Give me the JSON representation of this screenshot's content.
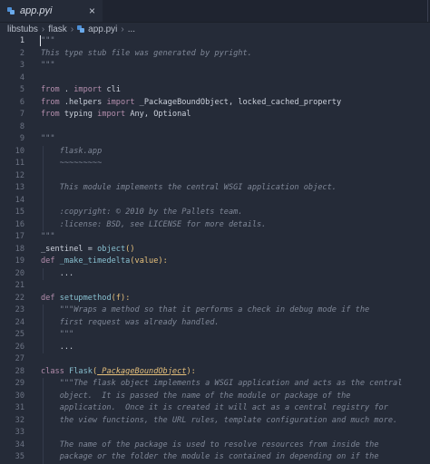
{
  "tab": {
    "label": "app.pyi",
    "close": "×"
  },
  "breadcrumb": [
    "libstubs",
    "flask",
    "app.pyi",
    "..."
  ],
  "lines": [
    {
      "n": "1",
      "parts": [
        {
          "t": "\"\"\"",
          "c": "str"
        }
      ]
    },
    {
      "n": "2",
      "parts": [
        {
          "t": "This type stub file was generated by pyright.",
          "c": "str"
        }
      ]
    },
    {
      "n": "3",
      "parts": [
        {
          "t": "\"\"\"",
          "c": "str"
        }
      ]
    },
    {
      "n": "4",
      "parts": []
    },
    {
      "n": "5",
      "parts": [
        {
          "t": "from",
          "c": "kw"
        },
        {
          "t": " . ",
          "c": "plain"
        },
        {
          "t": "import",
          "c": "kw"
        },
        {
          "t": " cli",
          "c": "plain"
        }
      ]
    },
    {
      "n": "6",
      "parts": [
        {
          "t": "from",
          "c": "kw"
        },
        {
          "t": " .helpers ",
          "c": "plain"
        },
        {
          "t": "import",
          "c": "kw"
        },
        {
          "t": " _PackageBoundObject, locked_cached_property",
          "c": "plain"
        }
      ]
    },
    {
      "n": "7",
      "parts": [
        {
          "t": "from",
          "c": "kw"
        },
        {
          "t": " typing ",
          "c": "plain"
        },
        {
          "t": "import",
          "c": "kw"
        },
        {
          "t": " Any, Optional",
          "c": "plain"
        }
      ]
    },
    {
      "n": "8",
      "parts": []
    },
    {
      "n": "9",
      "parts": [
        {
          "t": "\"\"\"",
          "c": "str"
        }
      ]
    },
    {
      "n": "10",
      "parts": [
        {
          "t": "    flask.app",
          "c": "str"
        }
      ]
    },
    {
      "n": "11",
      "parts": [
        {
          "t": "    ~~~~~~~~~",
          "c": "str"
        }
      ]
    },
    {
      "n": "12",
      "parts": []
    },
    {
      "n": "13",
      "parts": [
        {
          "t": "    This module implements the central WSGI application object.",
          "c": "str"
        }
      ]
    },
    {
      "n": "14",
      "parts": []
    },
    {
      "n": "15",
      "parts": [
        {
          "t": "    :copyright: © 2010 by the Pallets team.",
          "c": "str"
        }
      ]
    },
    {
      "n": "16",
      "parts": [
        {
          "t": "    :license: BSD, see LICENSE for more details.",
          "c": "str"
        }
      ]
    },
    {
      "n": "17",
      "parts": [
        {
          "t": "\"\"\"",
          "c": "str"
        }
      ]
    },
    {
      "n": "18",
      "parts": [
        {
          "t": "_sentinel = ",
          "c": "plain"
        },
        {
          "t": "object",
          "c": "fn"
        },
        {
          "t": "()",
          "c": "paren"
        }
      ]
    },
    {
      "n": "19",
      "parts": [
        {
          "t": "def",
          "c": "kw"
        },
        {
          "t": " ",
          "c": "plain"
        },
        {
          "t": "_make_timedelta",
          "c": "fn"
        },
        {
          "t": "(",
          "c": "paren"
        },
        {
          "t": "value",
          "c": "param"
        },
        {
          "t": "):",
          "c": "paren"
        }
      ]
    },
    {
      "n": "20",
      "parts": [
        {
          "t": "    ...",
          "c": "plain"
        }
      ]
    },
    {
      "n": "21",
      "parts": []
    },
    {
      "n": "22",
      "parts": [
        {
          "t": "def",
          "c": "kw"
        },
        {
          "t": " ",
          "c": "plain"
        },
        {
          "t": "setupmethod",
          "c": "fn"
        },
        {
          "t": "(",
          "c": "paren"
        },
        {
          "t": "f",
          "c": "param"
        },
        {
          "t": "):",
          "c": "paren"
        }
      ]
    },
    {
      "n": "23",
      "parts": [
        {
          "t": "    \"\"\"Wraps a method so that it performs a check in debug mode if the",
          "c": "str"
        }
      ]
    },
    {
      "n": "24",
      "parts": [
        {
          "t": "    first request was already handled.",
          "c": "str"
        }
      ]
    },
    {
      "n": "25",
      "parts": [
        {
          "t": "    \"\"\"",
          "c": "str"
        }
      ]
    },
    {
      "n": "26",
      "parts": [
        {
          "t": "    ...",
          "c": "plain"
        }
      ]
    },
    {
      "n": "27",
      "parts": []
    },
    {
      "n": "28",
      "parts": [
        {
          "t": "class",
          "c": "kw"
        },
        {
          "t": " ",
          "c": "plain"
        },
        {
          "t": "Flask",
          "c": "fn"
        },
        {
          "t": "(",
          "c": "paren"
        },
        {
          "t": "_PackageBoundObject",
          "c": "base"
        },
        {
          "t": "):",
          "c": "paren"
        }
      ]
    },
    {
      "n": "29",
      "parts": [
        {
          "t": "    \"\"\"The flask object implements a WSGI application and acts as the central",
          "c": "str"
        }
      ]
    },
    {
      "n": "30",
      "parts": [
        {
          "t": "    object.  It is passed the name of the module or package of the",
          "c": "str"
        }
      ]
    },
    {
      "n": "31",
      "parts": [
        {
          "t": "    application.  Once it is created it will act as a central registry for",
          "c": "str"
        }
      ]
    },
    {
      "n": "32",
      "parts": [
        {
          "t": "    the view functions, the URL rules, template configuration and much more.",
          "c": "str"
        }
      ]
    },
    {
      "n": "33",
      "parts": []
    },
    {
      "n": "34",
      "parts": [
        {
          "t": "    The name of the package is used to resolve resources from inside the",
          "c": "str"
        }
      ]
    },
    {
      "n": "35",
      "parts": [
        {
          "t": "    package or the folder the module is contained in depending on if the",
          "c": "str"
        }
      ]
    }
  ]
}
